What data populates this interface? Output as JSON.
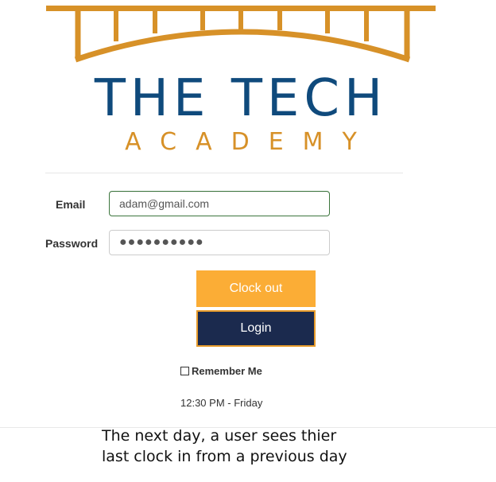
{
  "logo": {
    "title": "THE TECH",
    "subtitle": "ACADEMY",
    "title_color": "#0f4a7c",
    "accent_color": "#d79128"
  },
  "form": {
    "email_label": "Email",
    "email_value": "adam@gmail.com",
    "password_label": "Password",
    "password_value": "●●●●●●●●●●",
    "clock_out_label": "Clock out",
    "login_label": "Login",
    "remember_label": "Remember Me",
    "remember_checked": false,
    "timestamp": "12:30 PM - Friday"
  },
  "caption": {
    "line1": "The next day, a user sees thier",
    "line2": "last clock in from a previous day"
  },
  "colors": {
    "clock_out_bg": "#fbad36",
    "login_bg": "#1b2a4e",
    "login_border": "#e79b2b",
    "email_border_valid": "#3c763d"
  }
}
